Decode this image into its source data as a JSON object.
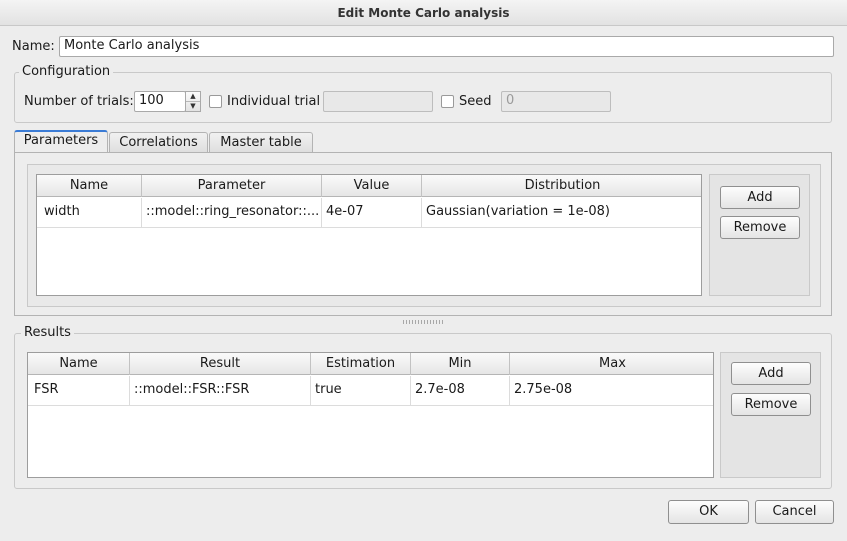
{
  "window": {
    "title": "Edit Monte Carlo analysis"
  },
  "name_field": {
    "label": "Name:",
    "value": "Monte Carlo analysis"
  },
  "configuration": {
    "title": "Configuration",
    "trials_label": "Number of trials:",
    "trials_value": "100",
    "individual_trial_label": "Individual trial",
    "individual_trial_value": "",
    "seed_label": "Seed",
    "seed_value": "0"
  },
  "tabs": [
    {
      "label": "Parameters",
      "active": true
    },
    {
      "label": "Correlations",
      "active": false
    },
    {
      "label": "Master table",
      "active": false
    }
  ],
  "parameters_table": {
    "columns": [
      "Name",
      "Parameter",
      "Value",
      "Distribution"
    ],
    "rows": [
      [
        "width",
        "::model::ring_resonator::...",
        "4e-07",
        "Gaussian(variation = 1e-08)"
      ]
    ],
    "add_label": "Add",
    "remove_label": "Remove"
  },
  "results": {
    "title": "Results",
    "columns": [
      "Name",
      "Result",
      "Estimation",
      "Min",
      "Max"
    ],
    "rows": [
      [
        "FSR",
        "::model::FSR::FSR",
        "true",
        "2.7e-08",
        "2.75e-08"
      ]
    ],
    "add_label": "Add",
    "remove_label": "Remove"
  },
  "footer": {
    "ok_label": "OK",
    "cancel_label": "Cancel"
  },
  "icons": {
    "spin_up": "▲",
    "spin_down": "▼"
  }
}
